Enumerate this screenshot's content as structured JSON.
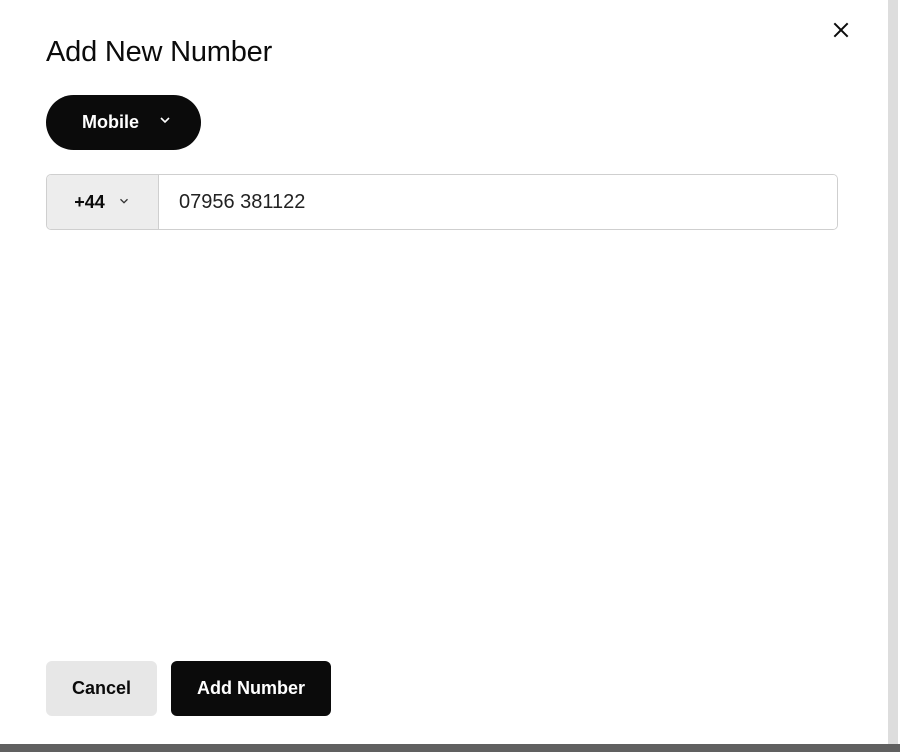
{
  "dialog": {
    "title": "Add New Number",
    "close_icon": "close-icon"
  },
  "numberType": {
    "selected": "Mobile"
  },
  "phone": {
    "countryCode": "+44",
    "value": "07956 381122"
  },
  "actions": {
    "cancel": "Cancel",
    "submit": "Add Number"
  }
}
